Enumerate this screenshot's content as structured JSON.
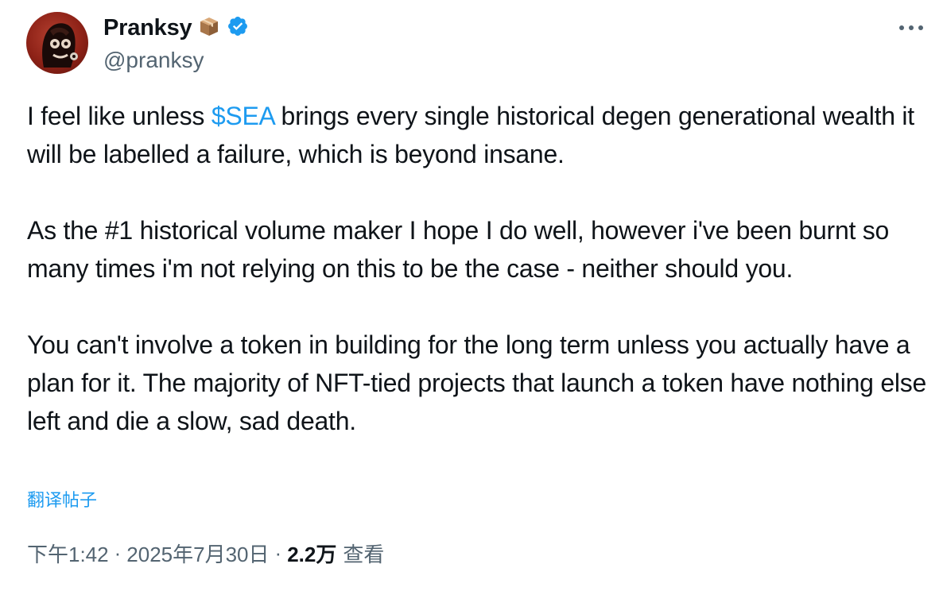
{
  "author": {
    "display_name": "Pranksy",
    "handle": "@pranksy",
    "emoji_badge": "package-box-icon",
    "verified_badge": "verified-check-icon",
    "colors": {
      "verified": "#1d9bf0"
    }
  },
  "tweet": {
    "paragraph1_before": "I feel like unless ",
    "cashtag": "$SEA",
    "paragraph1_after": " brings every single historical degen generational wealth it will be labelled a failure, which is beyond insane.",
    "paragraph2": "As the #1 historical volume maker I hope I do well, however i've been burnt so many times i'm not relying on this to be the case - neither should you.",
    "paragraph3": "You can't involve a token in building for the long term unless you actually have a plan for it. The majority of NFT-tied projects that launch a token have nothing else left and die a slow, sad death."
  },
  "translate_label": "翻译帖子",
  "meta": {
    "time": "下午1:42",
    "separator": "·",
    "date": "2025年7月30日",
    "views_count": "2.2万",
    "views_label": "查看"
  },
  "colors": {
    "link": "#1d9bf0",
    "text": "#0f1419",
    "secondary": "#536471"
  }
}
